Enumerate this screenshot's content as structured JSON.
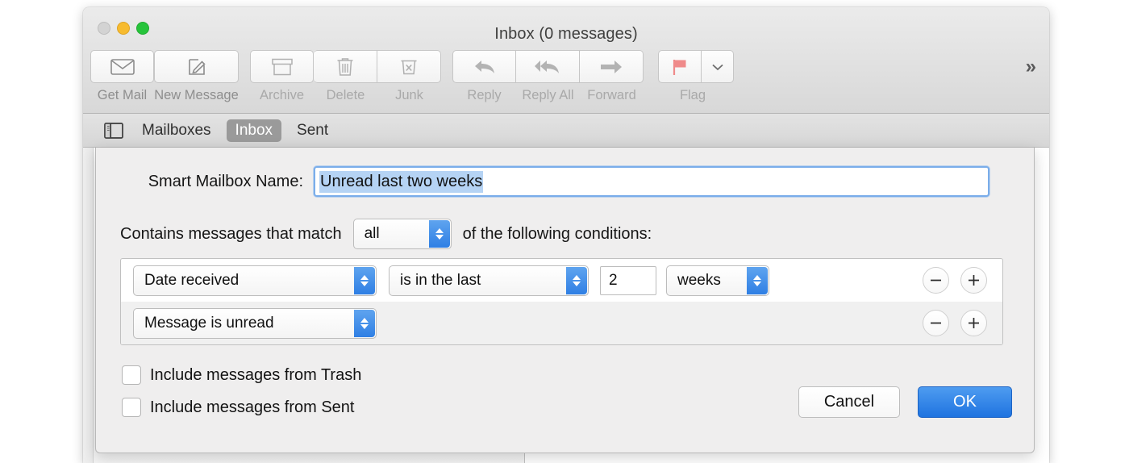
{
  "window": {
    "title": "Inbox (0 messages)",
    "traffic_lights": [
      "close-button",
      "minimize-button",
      "zoom-button"
    ]
  },
  "toolbar": {
    "overflow_label": "»",
    "groups": [
      {
        "items": [
          {
            "label": "Get Mail",
            "icon": "envelope-icon",
            "wide": false
          },
          {
            "label": "New Message",
            "icon": "compose-icon",
            "wide": true
          }
        ]
      },
      {
        "items": [
          {
            "label": "Archive",
            "icon": "archive-box-icon",
            "wide": false
          },
          {
            "label": "Delete",
            "icon": "trash-icon",
            "wide": false
          },
          {
            "label": "Junk",
            "icon": "junk-trash-x-icon",
            "wide": false
          }
        ]
      },
      {
        "items": [
          {
            "label": "Reply",
            "icon": "reply-arrow-icon",
            "wide": false
          },
          {
            "label": "Reply All",
            "icon": "reply-all-arrow-icon",
            "wide": false
          },
          {
            "label": "Forward",
            "icon": "forward-arrow-icon",
            "wide": false
          }
        ]
      }
    ],
    "flag": {
      "label": "Flag",
      "icon": "flag-icon",
      "chevron_icon": "chevron-down-icon",
      "color": "#ef8a8a"
    }
  },
  "tabbar": {
    "sidebar_toggle_icon": "sidebar-toggle-icon",
    "tabs": [
      {
        "label": "Mailboxes",
        "selected": false
      },
      {
        "label": "Inbox",
        "selected": true
      },
      {
        "label": "Sent",
        "selected": false
      }
    ],
    "selected_bg": "#9a9a9a"
  },
  "dialog": {
    "name_label": "Smart Mailbox Name:",
    "name_value": "Unread last two weeks",
    "name_selection_color": "#b5d3f4",
    "match_prefix": "Contains messages that match",
    "match_value": "all",
    "match_suffix": "of the following conditions:",
    "conditions": [
      {
        "field": "Date received",
        "operator": "is in the last",
        "number": "2",
        "unit": "weeks",
        "remove_label": "−",
        "add_label": "+"
      },
      {
        "field": "Message is unread",
        "operator": null,
        "number": null,
        "unit": null,
        "remove_label": "−",
        "add_label": "+"
      }
    ],
    "checkboxes": [
      {
        "label": "Include messages from Trash",
        "checked": false
      },
      {
        "label": "Include messages from Sent",
        "checked": false
      }
    ],
    "cancel_label": "Cancel",
    "ok_label": "OK",
    "ok_color": "#2f7fe4"
  }
}
